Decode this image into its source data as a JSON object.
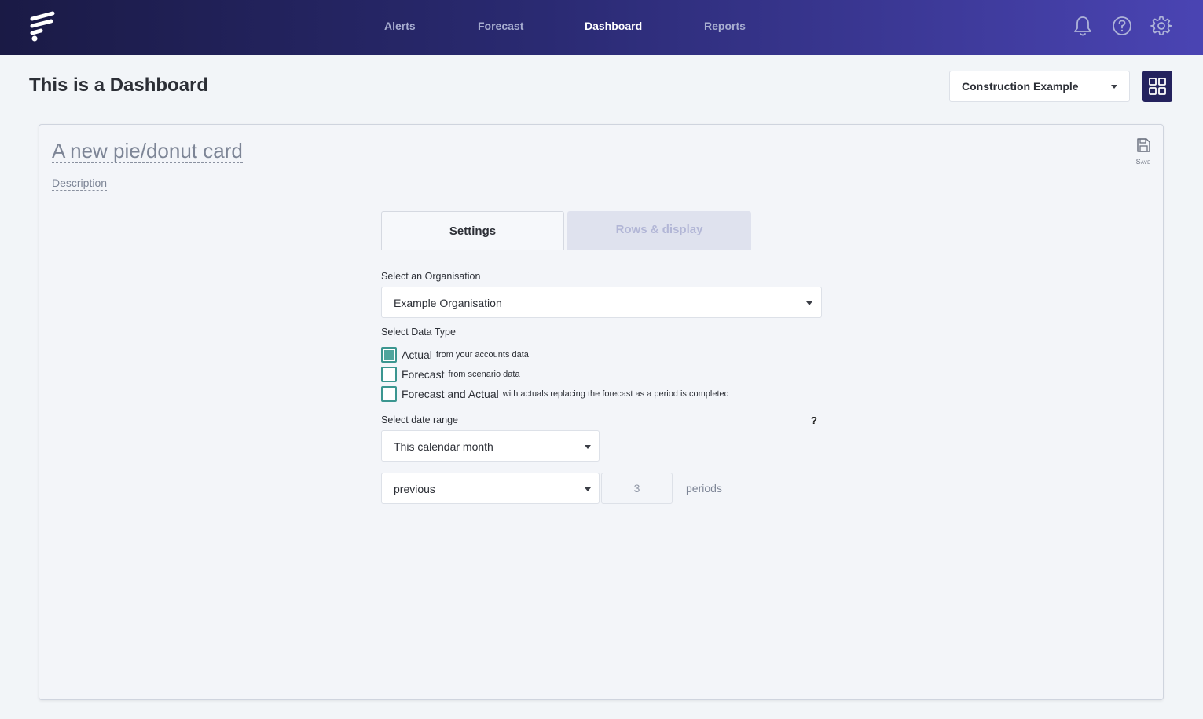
{
  "nav": {
    "items": [
      {
        "label": "Alerts",
        "active": false
      },
      {
        "label": "Forecast",
        "active": false
      },
      {
        "label": "Dashboard",
        "active": true
      },
      {
        "label": "Reports",
        "active": false
      }
    ],
    "icons": [
      "bell-icon",
      "help-circle-icon",
      "gear-icon"
    ]
  },
  "header": {
    "title": "This is a Dashboard",
    "org_select": "Construction Example",
    "layout_icon": "grid-icon"
  },
  "card": {
    "title": "A new pie/donut card",
    "description": "Description",
    "save_label": "Save",
    "tabs": [
      {
        "label": "Settings",
        "active": true
      },
      {
        "label": "Rows & display",
        "active": false
      }
    ],
    "organisation": {
      "label": "Select an Organisation",
      "value": "Example Organisation"
    },
    "data_type": {
      "label": "Select Data Type",
      "options": [
        {
          "label": "Actual",
          "hint": "from your accounts data",
          "checked": true
        },
        {
          "label": "Forecast",
          "hint": "from scenario data",
          "checked": false
        },
        {
          "label": "Forecast and Actual",
          "hint": "with actuals replacing the forecast as a period is completed",
          "checked": false
        }
      ]
    },
    "date_range": {
      "label": "Select date range",
      "help": "?",
      "value": "This calendar month",
      "direction": "previous",
      "count": "3",
      "unit": "periods"
    }
  },
  "colors": {
    "nav_start": "#1a1a45",
    "nav_end": "#4a44b3",
    "accent_teal": "#3b9690",
    "grid_button": "#24225e"
  }
}
